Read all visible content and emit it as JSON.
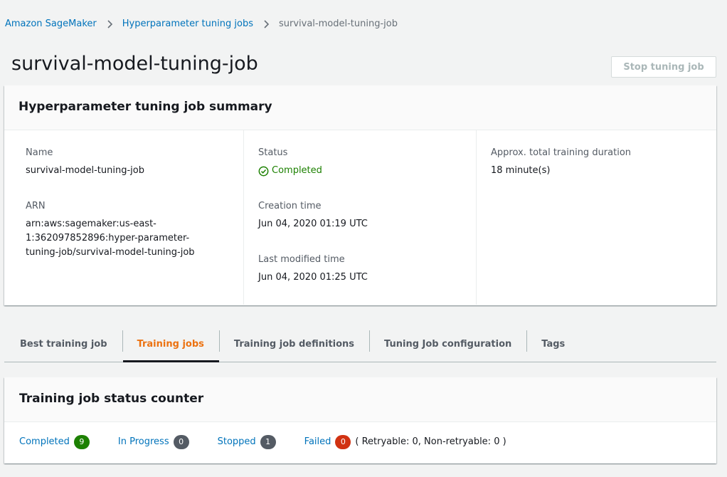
{
  "breadcrumb": {
    "items": [
      {
        "label": "Amazon SageMaker"
      },
      {
        "label": "Hyperparameter tuning jobs"
      },
      {
        "label": "survival-model-tuning-job"
      }
    ]
  },
  "header": {
    "title": "survival-model-tuning-job",
    "stop_button_label": "Stop tuning job"
  },
  "summary": {
    "title": "Hyperparameter tuning job summary",
    "name_label": "Name",
    "name_value": "survival-model-tuning-job",
    "arn_label": "ARN",
    "arn_value": "arn:aws:sagemaker:us-east-1:362097852896:hyper-parameter-tuning-job/survival-model-tuning-job",
    "status_label": "Status",
    "status_value": "Completed",
    "creation_label": "Creation time",
    "creation_value": "Jun 04, 2020 01:19 UTC",
    "modified_label": "Last modified time",
    "modified_value": "Jun 04, 2020 01:25 UTC",
    "duration_label": "Approx. total training duration",
    "duration_value": "18 minute(s)"
  },
  "tabs": [
    {
      "label": "Best training job",
      "active": false
    },
    {
      "label": "Training jobs",
      "active": true
    },
    {
      "label": "Training job definitions",
      "active": false
    },
    {
      "label": "Tuning Job configuration",
      "active": false
    },
    {
      "label": "Tags",
      "active": false
    }
  ],
  "counter": {
    "title": "Training job status counter",
    "completed_label": "Completed",
    "completed_count": "9",
    "in_progress_label": "In Progress",
    "in_progress_count": "0",
    "stopped_label": "Stopped",
    "stopped_count": "1",
    "failed_label": "Failed",
    "failed_count": "0",
    "failed_detail": "( Retryable: 0, Non-retryable: 0 )"
  },
  "colors": {
    "link": "#0073bb",
    "success": "#1d8102",
    "active_tab": "#ec7211",
    "failed_badge": "#d13212",
    "neutral_badge": "#545b64"
  },
  "icons": {
    "breadcrumb_separator": "chevron-right-icon",
    "status": "check-circle-icon"
  }
}
